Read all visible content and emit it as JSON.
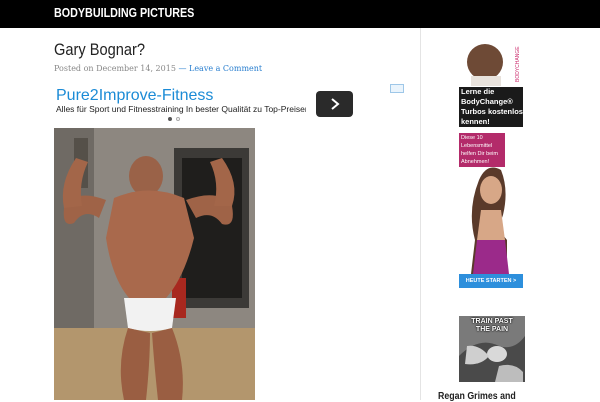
{
  "site": {
    "title": "BODYBUILDING PICTURES"
  },
  "post": {
    "title": "Gary Bognar?",
    "meta_prefix": "Posted on",
    "date": "December 14, 2015",
    "separator": "—",
    "comment_link": "Leave a Comment"
  },
  "ad": {
    "title": "Pure2Improve-Fitness",
    "text": "Alles für Sport und Fitnesstraining In bester Qualität zu Top-Preisen",
    "button_icon": "chevron-right-icon",
    "carousel_active": 1
  },
  "sidebar_ad": {
    "headline_lines": [
      "Lerne die",
      "BodyChange®",
      "Turbos kostenlos",
      "kennen!"
    ],
    "sub_lines": [
      "Diese 10 Lebensmittel",
      "helfen Dir beim",
      "Abnehmen!"
    ],
    "cta": "HEUTE STARTEN >",
    "brand": "BODYCHANGE"
  },
  "meme": {
    "text_lines": [
      "TRAIN PAST",
      "THE PAIN"
    ]
  },
  "widget": {
    "title": "Regan Grimes and"
  }
}
